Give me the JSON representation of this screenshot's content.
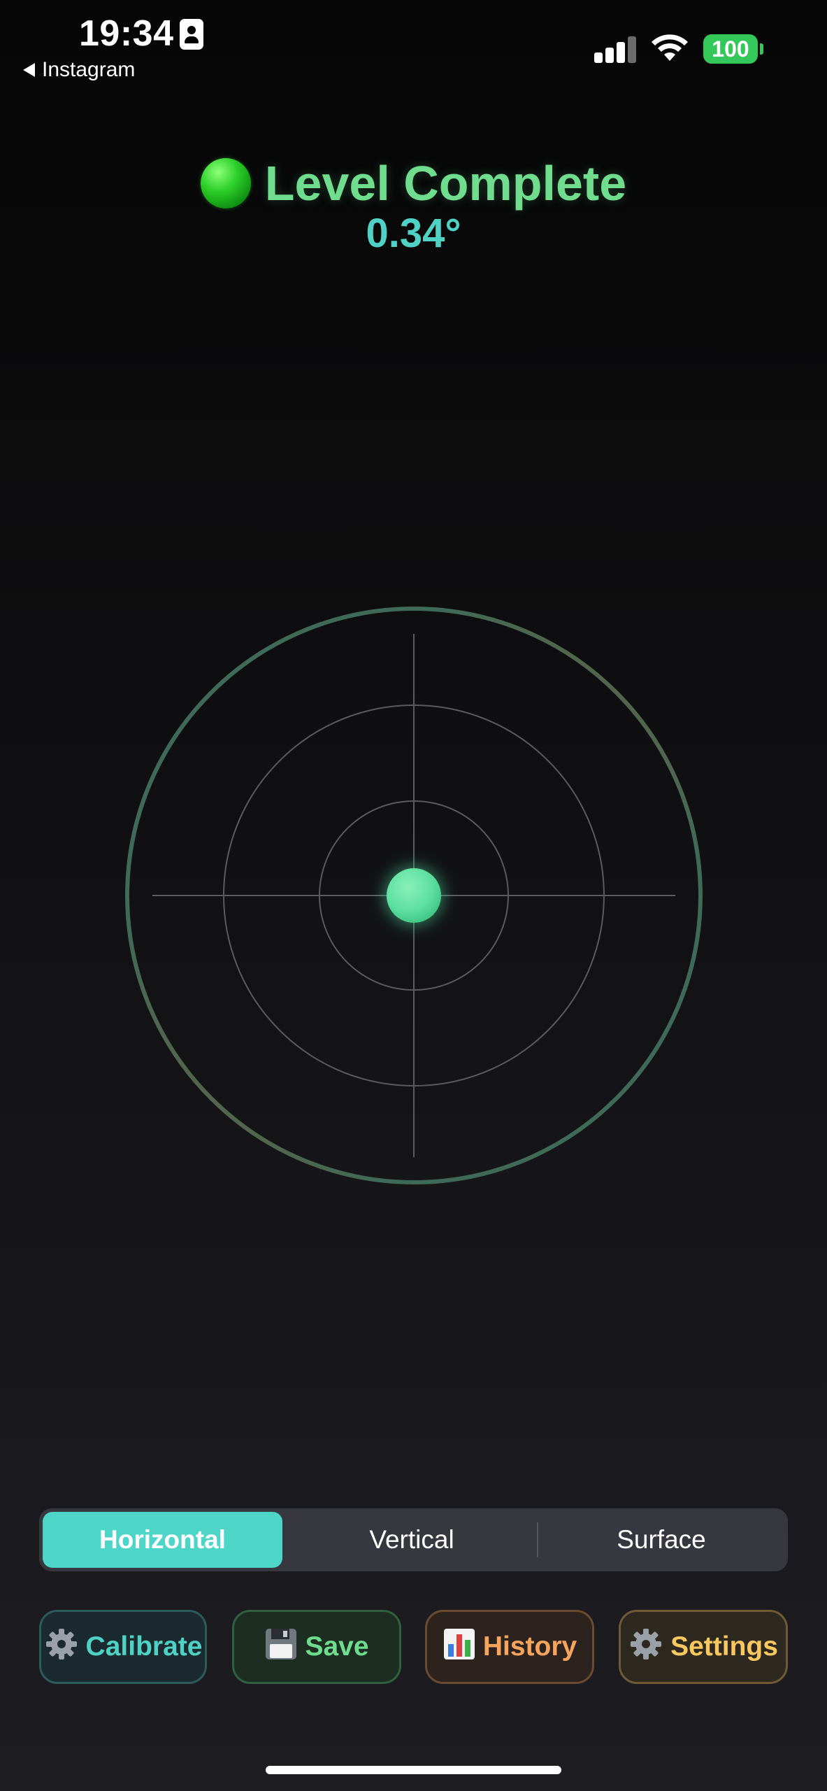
{
  "status_bar": {
    "time": "19:34",
    "battery": "100",
    "back_label": "Instagram",
    "icons": [
      "person-badge-icon",
      "cellular-signal-icon",
      "wifi-icon",
      "battery-icon"
    ]
  },
  "header": {
    "title": "Level Complete",
    "angle": "0.34°",
    "status_indicator": "green-dot"
  },
  "level": {
    "bubble_color": "#5ee0a0",
    "outer_ring_colors": [
      "#3f6a58",
      "#7a5a34"
    ]
  },
  "segmented": {
    "options": [
      "Horizontal",
      "Vertical",
      "Surface"
    ],
    "selected": "Horizontal"
  },
  "actions": [
    {
      "icon": "gear-icon",
      "label": "Calibrate",
      "color": "#4fd1c5"
    },
    {
      "icon": "floppy-disk-icon",
      "label": "Save",
      "color": "#6fdc8e"
    },
    {
      "icon": "bar-chart-icon",
      "label": "History",
      "color": "#f5a55e"
    },
    {
      "icon": "gear-icon",
      "label": "Settings",
      "color": "#f9c85e"
    }
  ],
  "colors": {
    "accent_teal": "#4dd6c8",
    "title_green": "#6fdc8e",
    "background": "#0f0f11"
  }
}
